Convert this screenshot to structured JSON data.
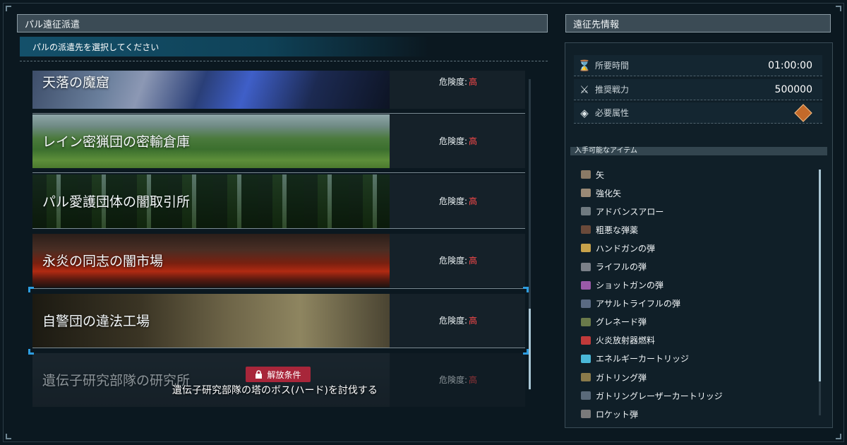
{
  "left_panel": {
    "title": "パル遠征派遣",
    "subtitle": "パルの派遣先を選択してください"
  },
  "danger_label": "危険度:",
  "destinations": [
    {
      "name": "天落の魔窟",
      "danger": "高"
    },
    {
      "name": "レイン密猟団の密輸倉庫",
      "danger": "高"
    },
    {
      "name": "パル愛護団体の闇取引所",
      "danger": "高"
    },
    {
      "name": "永炎の同志の闇市場",
      "danger": "高"
    },
    {
      "name": "自警団の違法工場",
      "danger": "高"
    },
    {
      "name": "遺伝子研究部隊の研究所",
      "danger": "高"
    }
  ],
  "lock": {
    "badge": "解放条件",
    "condition": "遺伝子研究部隊の塔のボス(ハード)を討伐する"
  },
  "right_panel": {
    "title": "遠征先情報",
    "required_time_label": "所要時間",
    "required_time": "01:00:00",
    "recommended_power_label": "推奨戦力",
    "recommended_power": "500000",
    "required_element_label": "必要属性",
    "items_label": "入手可能なアイテム"
  },
  "items": [
    {
      "name": "矢",
      "color": "#8a7a66"
    },
    {
      "name": "強化矢",
      "color": "#9a8a76"
    },
    {
      "name": "アドバンスアロー",
      "color": "#6f7a80"
    },
    {
      "name": "粗悪な弾薬",
      "color": "#6a4a3a"
    },
    {
      "name": "ハンドガンの弾",
      "color": "#c7a24a"
    },
    {
      "name": "ライフルの弾",
      "color": "#7a8088"
    },
    {
      "name": "ショットガンの弾",
      "color": "#9a5aa8"
    },
    {
      "name": "アサルトライフルの弾",
      "color": "#5a6a82"
    },
    {
      "name": "グレネード弾",
      "color": "#6a7a4a"
    },
    {
      "name": "火炎放射器燃料",
      "color": "#c03a3a"
    },
    {
      "name": "エネルギーカートリッジ",
      "color": "#4ab8d8"
    },
    {
      "name": "ガトリング弾",
      "color": "#8a7a4a"
    },
    {
      "name": "ガトリングレーザーカートリッジ",
      "color": "#5a6a7a"
    },
    {
      "name": "ロケット弾",
      "color": "#7a7a7a"
    }
  ]
}
